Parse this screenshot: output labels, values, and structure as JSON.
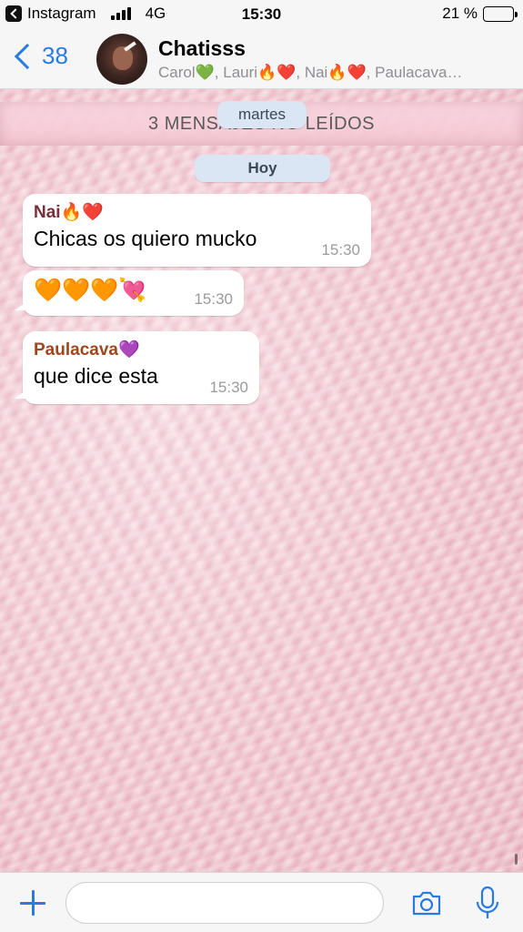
{
  "status_bar": {
    "back_app": "Instagram",
    "network": "4G",
    "time": "15:30",
    "battery_percent": "21 %",
    "battery_level": 0.21
  },
  "nav": {
    "back_count": "38",
    "title": "Chatisss",
    "subtitle": "Carol💚, Lauri🔥❤️, Nai🔥❤️, Paulacava…"
  },
  "chat": {
    "unread_banner": "3 MENSAJES NO LEÍDOS",
    "pill_martes": "martes",
    "pill_hoy": "Hoy",
    "messages": [
      {
        "sender": "Nai🔥❤️",
        "sender_color": "#7b2d3a",
        "text": "Chicas os quiero mucko",
        "time": "15:30"
      },
      {
        "sender": "",
        "text": "🧡🧡🧡💘",
        "time": "15:30"
      },
      {
        "sender": "Paulacava💜",
        "sender_color": "#a0461f",
        "text": "que dice esta",
        "time": "15:30"
      }
    ]
  },
  "input_bar": {
    "placeholder": "",
    "icons": [
      "plus-icon",
      "camera-icon",
      "microphone-icon"
    ]
  },
  "colors": {
    "accent": "#2a7ae4",
    "bubble": "#ffffff",
    "date_pill": "#dbe6f4"
  }
}
